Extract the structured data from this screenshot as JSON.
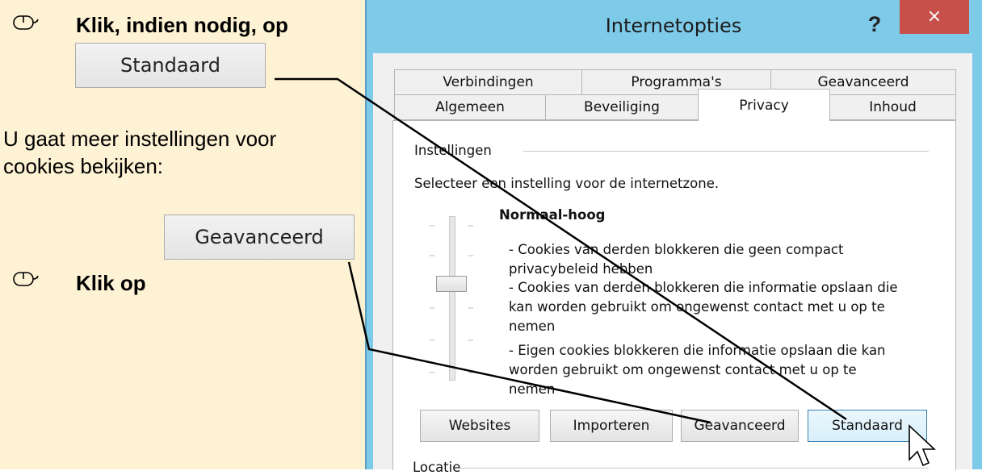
{
  "instructions": {
    "step1_text": "Klik, indien nodig, op",
    "step1_button": "Standaard",
    "info_line1": "U gaat meer instellingen voor",
    "info_line2": "cookies bekijken:",
    "step2_text": "Klik op",
    "step2_button": "Geavanceerd"
  },
  "dialog": {
    "title": "Internetopties",
    "help": "?",
    "close": "×",
    "tabs_row1": [
      "Verbindingen",
      "Programma's",
      "Geavanceerd"
    ],
    "tabs_row2": [
      "Algemeen",
      "Beveiliging",
      "Privacy",
      "Inhoud"
    ],
    "active_tab": "Privacy",
    "settings_group": "Instellingen",
    "select_prompt": "Selecteer een instelling voor de internetzone.",
    "level_name": "Normaal-hoog",
    "description_lines": [
      "- Cookies van derden blokkeren die geen compact",
      "privacybeleid hebben",
      "- Cookies van derden blokkeren die informatie opslaan die",
      "kan worden gebruikt om ongewenst contact met u op te",
      "nemen",
      "- Eigen cookies blokkeren die informatie opslaan die kan",
      "worden gebruikt om ongewenst contact met u op te",
      "nemen"
    ],
    "buttons": [
      "Websites",
      "Importeren",
      "Geavanceerd",
      "Standaard"
    ],
    "location_group": "Locatie"
  },
  "colors": {
    "instruction_background": "#fdf2d4",
    "window_frame": "#7ecae9",
    "close_button": "#c7504a"
  }
}
